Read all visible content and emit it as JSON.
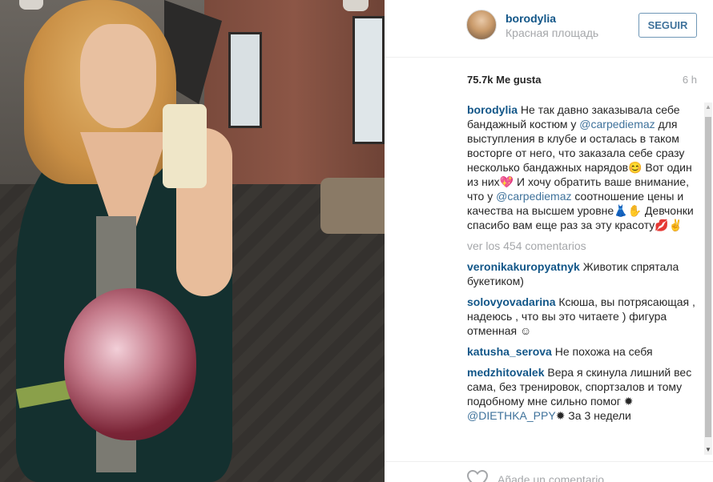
{
  "post": {
    "username": "borodylia",
    "location": "Красная площадь",
    "follow_label": "SEGUIR",
    "likes": "75.7k Me gusta",
    "time_ago": "6 h",
    "caption": {
      "user": "borodylia",
      "text_parts": [
        "Не так давно заказывала себе бандажный костюм у ",
        "@carpediemaz",
        " для выступления в клубе и осталась в таком восторге от него, что заказала себе сразу несколько бандажных нарядов😊 Вот один из них💖 И хочу обратить ваше внимание, что у ",
        "@carpediemaz",
        " соотношение цены и качества на высшем уровне👗✋ Девчонки спасибо вам еще раз за эту красоту💋✌"
      ]
    },
    "view_all_comments": "ver los 454 comentarios",
    "comments": [
      {
        "user": "veronikakuropyatnyk",
        "text": "Животик спрятала букетиком)"
      },
      {
        "user": "solovyovadarina",
        "text": "Ксюша, вы потрясающая , надеюсь , что вы это читаете ) фигура отменная ☺"
      },
      {
        "user": "katusha_serova",
        "text": "Не похожа на себя"
      },
      {
        "user": "medzhitovalek",
        "text_parts": [
          "Вера я скинула лишний вес сама, без тренировок, спортзалов и тому подобному мне сильно помог ✹ ",
          "@DIETHKA_PPY",
          "✹ За 3 недели"
        ]
      }
    ],
    "add_comment_placeholder": "Añade un comentario..."
  },
  "icons": {
    "heart": "heart-outline-icon",
    "scroll_up": "▲",
    "scroll_down": "▼"
  },
  "colors": {
    "username": "#125688",
    "follow_border": "#6f97b6",
    "follow_text": "#3f729b",
    "muted": "#a5a7aa",
    "mention": "#3f729b"
  }
}
